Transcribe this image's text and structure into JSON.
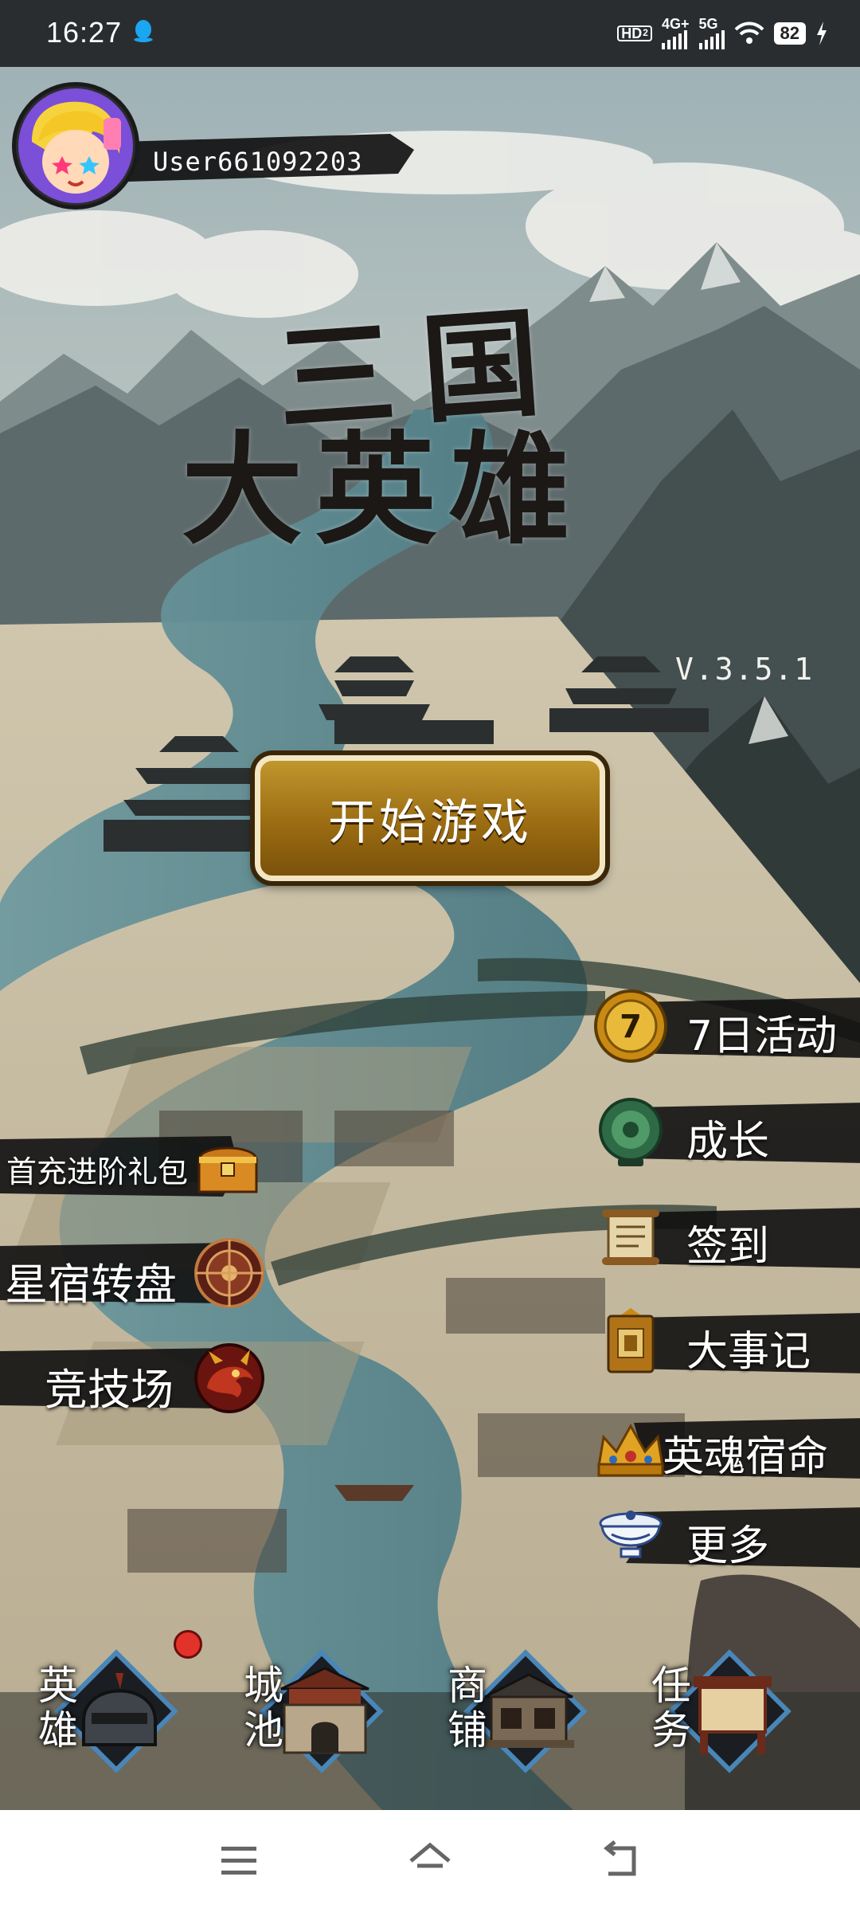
{
  "status_bar": {
    "time": "16:27",
    "hd": "HD",
    "hd_sub": "2",
    "net_4g": "4G+",
    "net_5g": "5G",
    "battery": "82"
  },
  "user": {
    "name": "User661092203"
  },
  "title": {
    "line1": "三国",
    "line2": "大英雄",
    "version": "V.3.5.1"
  },
  "start_button": {
    "label": "开始游戏"
  },
  "right_menu": [
    {
      "label": "7日活动",
      "icon": "coin-7-icon",
      "badge": "7"
    },
    {
      "label": "成长",
      "icon": "jade-icon"
    },
    {
      "label": "签到",
      "icon": "scroll-icon"
    },
    {
      "label": "大事记",
      "icon": "book-icon"
    },
    {
      "label": "英魂宿命",
      "icon": "crown-icon"
    },
    {
      "label": "更多",
      "icon": "bowl-icon"
    }
  ],
  "left_menu": [
    {
      "label": "首充进阶礼包",
      "icon": "chest-icon"
    },
    {
      "label": "星宿转盘",
      "icon": "wheel-icon"
    },
    {
      "label": "竞技场",
      "icon": "dragon-icon"
    }
  ],
  "bottom_tabs": [
    {
      "label": "英雄",
      "icon": "helmet-icon"
    },
    {
      "label": "城池",
      "icon": "gate-icon"
    },
    {
      "label": "商铺",
      "icon": "shop-icon"
    },
    {
      "label": "任务",
      "icon": "quest-board-icon"
    }
  ],
  "colors": {
    "gold": "#a77612",
    "ink": "#141414",
    "river": "#5e8b93",
    "badge_red": "#e3322a"
  }
}
